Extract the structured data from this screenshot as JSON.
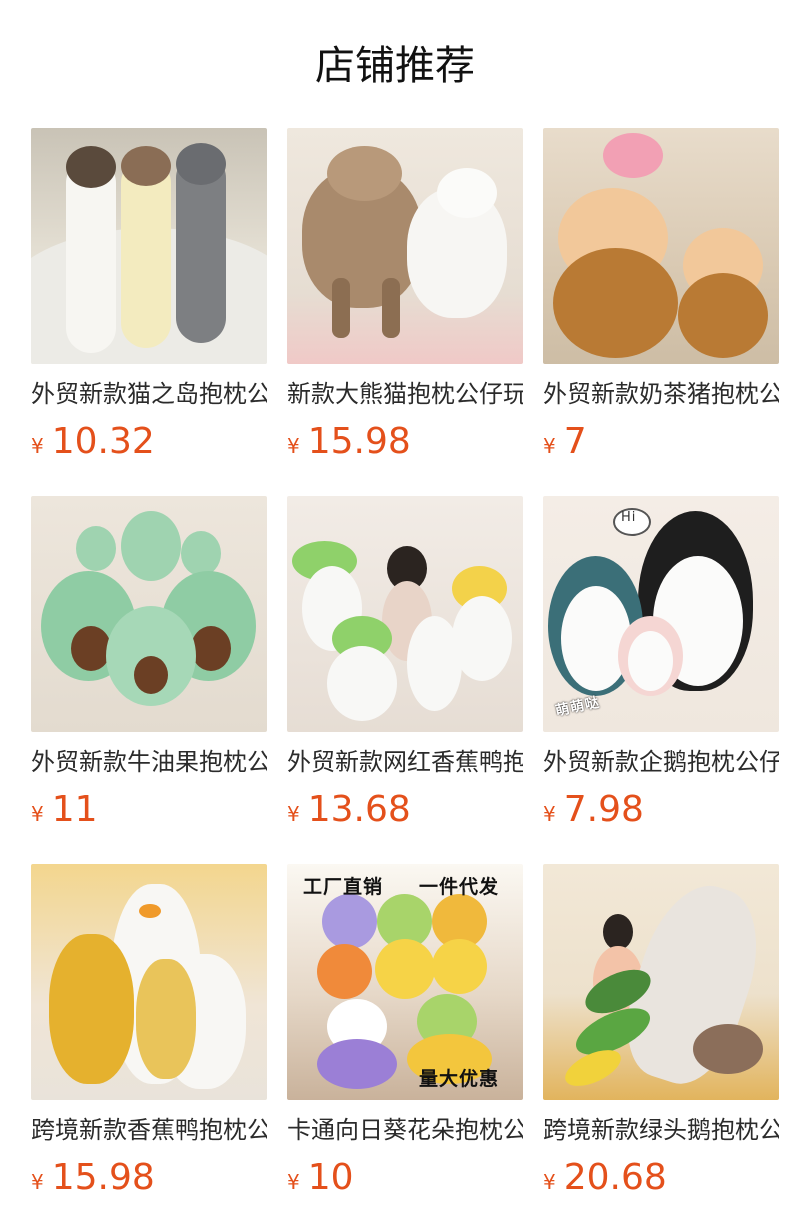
{
  "header": {
    "title": "店铺推荐"
  },
  "currency_symbol": "¥",
  "products": [
    {
      "name": "外贸新款猫之岛抱枕公仔",
      "price": "10.32",
      "image": "long-cat-pillow-image"
    },
    {
      "name": "新款大熊猫抱枕公仔玩偶",
      "price": "15.98",
      "image": "plush-sheep-alpaca-image"
    },
    {
      "name": "外贸新款奶茶猪抱枕公仔",
      "price": "7",
      "image": "milk-tea-pig-image"
    },
    {
      "name": "外贸新款牛油果抱枕公仔",
      "price": "11",
      "image": "avocado-plush-image"
    },
    {
      "name": "外贸新款网红香蕉鸭抱枕",
      "price": "13.68",
      "image": "banana-duck-plush-image"
    },
    {
      "name": "外贸新款企鹅抱枕公仔玩",
      "price": "7.98",
      "image": "penguin-plush-image",
      "overlay": {
        "bubble": "Hi",
        "tag": "萌萌哒"
      }
    },
    {
      "name": "跨境新款香蕉鸭抱枕公仔",
      "price": "15.98",
      "image": "banana-duck-pillow-image"
    },
    {
      "name": "卡通向日葵花朵抱枕公仔",
      "price": "10",
      "image": "sunflower-cushion-image",
      "overlay": {
        "top_left": "工厂直销",
        "top_right": "一件代发",
        "bottom": "量大优惠"
      }
    },
    {
      "name": "跨境新款绿头鹅抱枕公仔",
      "price": "20.68",
      "image": "mallard-duck-pillow-image"
    }
  ]
}
